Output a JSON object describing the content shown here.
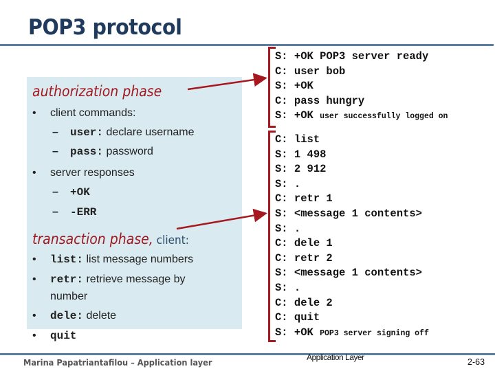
{
  "slide": {
    "title": "POP3 protocol",
    "authorization": {
      "heading": "authorization phase",
      "items": [
        {
          "bullet": "•",
          "text": "client commands:"
        },
        {
          "dash": "–",
          "code": "user:",
          "text": " declare username"
        },
        {
          "dash": "–",
          "code": "pass:",
          "text": " password"
        },
        {
          "bullet": "•",
          "text": "server responses"
        },
        {
          "dash": "–",
          "code": "+OK",
          "text": ""
        },
        {
          "dash": "–",
          "code": "-ERR",
          "text": ""
        }
      ]
    },
    "transaction": {
      "heading": "transaction phase,",
      "heading_suffix": " client:",
      "items": [
        {
          "bullet": "•",
          "code": "list:",
          "text": " list message numbers"
        },
        {
          "bullet": "•",
          "code": "retr:",
          "text": " retrieve message by"
        },
        {
          "bullet": "",
          "code": "",
          "text": "number"
        },
        {
          "bullet": "•",
          "code": "dele:",
          "text": " delete"
        },
        {
          "bullet": "•",
          "code": "quit",
          "text": ""
        }
      ]
    },
    "auth_exchange": [
      {
        "who": "S:",
        "msg": " +OK POP3 server ready",
        "small": ""
      },
      {
        "who": "C:",
        "msg": " user bob",
        "small": ""
      },
      {
        "who": "S:",
        "msg": " +OK",
        "small": ""
      },
      {
        "who": "C:",
        "msg": " pass hungry",
        "small": ""
      },
      {
        "who": "S:",
        "msg": " +OK ",
        "small": "user successfully logged on"
      }
    ],
    "transaction_exchange": [
      {
        "who": "C:",
        "msg": " list",
        "small": ""
      },
      {
        "who": "S:",
        "msg": " 1 498",
        "small": ""
      },
      {
        "who": "S:",
        "msg": " 2 912",
        "small": ""
      },
      {
        "who": "S:",
        "msg": " .",
        "small": ""
      },
      {
        "who": "C:",
        "msg": " retr 1",
        "small": ""
      },
      {
        "who": "S:",
        "msg": " <message 1 contents>",
        "small": ""
      },
      {
        "who": "S:",
        "msg": " .",
        "small": ""
      },
      {
        "who": "C:",
        "msg": " dele 1",
        "small": ""
      },
      {
        "who": "C:",
        "msg": " retr 2",
        "small": ""
      },
      {
        "who": "S:",
        "msg": " <message 1 contents>",
        "small": ""
      },
      {
        "who": "S:",
        "msg": " .",
        "small": ""
      },
      {
        "who": "C:",
        "msg": " dele 2",
        "small": ""
      },
      {
        "who": "C:",
        "msg": " quit",
        "small": ""
      },
      {
        "who": "S:",
        "msg": " +OK ",
        "small": "POP3 server signing off"
      }
    ],
    "footer": {
      "author": "Marina Papatriantafilou –  Application layer",
      "section": "Application Layer",
      "page": "2-63"
    },
    "colors": {
      "title": "#1f3a5c",
      "rule": "#5a7fa0",
      "panel": "#daeaf1",
      "accent_red": "#a01820"
    }
  }
}
